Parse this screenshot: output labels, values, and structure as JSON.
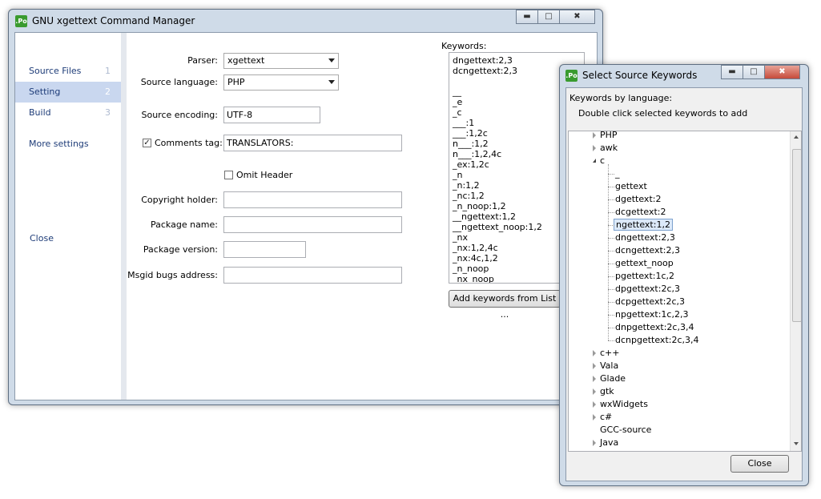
{
  "main_window": {
    "title": "GNU xgettext Command Manager",
    "icon_text": ".Po",
    "nav": [
      {
        "label": "Source Files",
        "num": "1"
      },
      {
        "label": "Setting",
        "num": "2"
      },
      {
        "label": "Build",
        "num": "3"
      }
    ],
    "more_settings": "More settings",
    "close_label": "Close",
    "form": {
      "parser_label": "Parser:",
      "parser_value": "xgettext",
      "source_language_label": "Source language:",
      "source_language_value": "PHP",
      "source_encoding_label": "Source encoding:",
      "source_encoding_value": "UTF-8",
      "comments_tag_label": "Comments tag:",
      "comments_tag_value": "TRANSLATORS:",
      "omit_header_label": "Omit Header",
      "copyright_label": "Copyright holder:",
      "package_name_label": "Package name:",
      "package_version_label": "Package version:",
      "msgid_bugs_label": "Msgid bugs address:"
    },
    "keywords_label": "Keywords:",
    "keywords": [
      "dngettext:2,3",
      "dcngettext:2,3",
      "",
      "__",
      "_e",
      "_c",
      "___:1",
      "___:1,2c",
      "n___:1,2",
      "n___:1,2,4c",
      "_ex:1,2c",
      "_n",
      "_n:1,2",
      "_nc:1,2",
      "_n_noop:1,2",
      "__ngettext:1,2",
      "__ngettext_noop:1,2",
      "_nx",
      "_nx:1,2,4c",
      "_nx:4c,1,2",
      "_n_noop",
      "_nx_noop"
    ],
    "add_keywords_button": "Add keywords from List ..."
  },
  "dialog": {
    "title": "Select Source Keywords",
    "icon_text": ".Po",
    "heading": "Keywords by language:",
    "hint": "Double click selected keywords to add",
    "tree_top": [
      "PHP",
      "awk"
    ],
    "tree_open": "c",
    "c_children": [
      "_",
      "gettext",
      "dgettext:2",
      "dcgettext:2",
      "ngettext:1,2",
      "dngettext:2,3",
      "dcngettext:2,3",
      "gettext_noop",
      "pgettext:1c,2",
      "dpgettext:2c,3",
      "dcpgettext:2c,3",
      "npgettext:1c,2,3",
      "dnpgettext:2c,3,4",
      "dcnpgettext:2c,3,4"
    ],
    "selected_child": "ngettext:1,2",
    "tree_bottom": [
      "c++",
      "Vala",
      "Glade",
      "gtk",
      "wxWidgets",
      "c#",
      "GCC-source",
      "Java"
    ],
    "close_button": "Close"
  }
}
